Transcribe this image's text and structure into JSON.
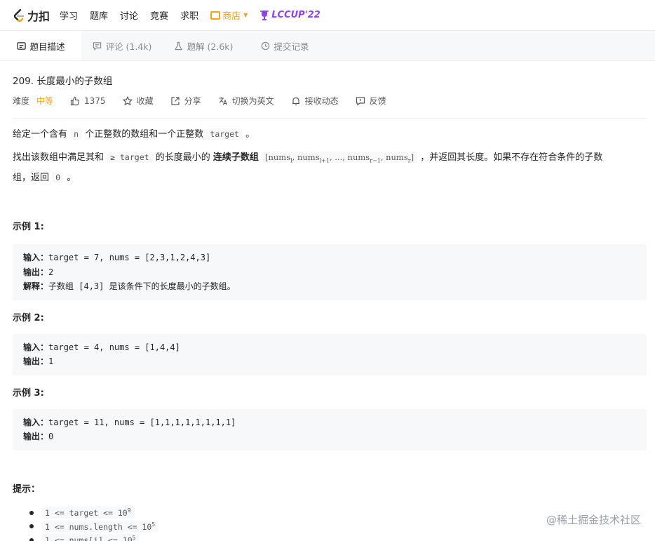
{
  "nav": {
    "logo_text": "力扣",
    "items": [
      "学习",
      "题库",
      "讨论",
      "竞赛",
      "求职"
    ],
    "store": "商店",
    "contest": "LCCUP'22"
  },
  "tabs": [
    {
      "label": "题目描述",
      "icon": "description-icon"
    },
    {
      "label": "评论 (1.4k)",
      "icon": "comment-icon"
    },
    {
      "label": "题解 (2.6k)",
      "icon": "flask-icon"
    },
    {
      "label": "提交记录",
      "icon": "clock-icon"
    }
  ],
  "problem": {
    "title": "209. 长度最小的子数组",
    "difficulty_label": "难度",
    "difficulty": "中等",
    "likes": "1375",
    "favorite": "收藏",
    "share": "分享",
    "switch_lang": "切换为英文",
    "follow": "接收动态",
    "feedback": "反馈"
  },
  "description": {
    "p1_a": "给定一个含有",
    "p1_n": "n",
    "p1_b": "个正整数的数组和一个正整数",
    "p1_target": "target",
    "p1_end": "。",
    "p2_a": "找出该数组中满足其和",
    "p2_ge": "≥ target",
    "p2_b": "的长度最小的",
    "p2_bold": "连续子数组",
    "p2_math": "[nums",
    "p2_c": "，并返回其长度。如果不存在符合条件的子数",
    "p2_d": "组，返回",
    "p2_zero": "0",
    "p2_end": "。"
  },
  "examples": [
    {
      "title": "示例 1:",
      "input_label": "输入：",
      "input": "target = 7, nums = [2,3,1,2,4,3]",
      "output_label": "输出：",
      "output": "2",
      "explain_label": "解释：",
      "explain": "子数组 [4,3] 是该条件下的长度最小的子数组。"
    },
    {
      "title": "示例 2:",
      "input_label": "输入：",
      "input": "target = 4, nums = [1,4,4]",
      "output_label": "输出：",
      "output": "1"
    },
    {
      "title": "示例 3:",
      "input_label": "输入：",
      "input": "target = 11, nums = [1,1,1,1,1,1,1,1]",
      "output_label": "输出：",
      "output": "0"
    }
  ],
  "hints": {
    "title": "提示：",
    "items": [
      {
        "text": "1 <= target <= 10",
        "sup": "9"
      },
      {
        "text": "1 <= nums.length <= 10",
        "sup": "5"
      },
      {
        "text": "1 <= nums[i] <= 10",
        "sup": "5"
      }
    ]
  },
  "watermark": "@稀土掘金技术社区",
  "colors": {
    "accent": "#ffa116",
    "contest": "#8e44ec",
    "code_bg": "#f7f8fa"
  }
}
